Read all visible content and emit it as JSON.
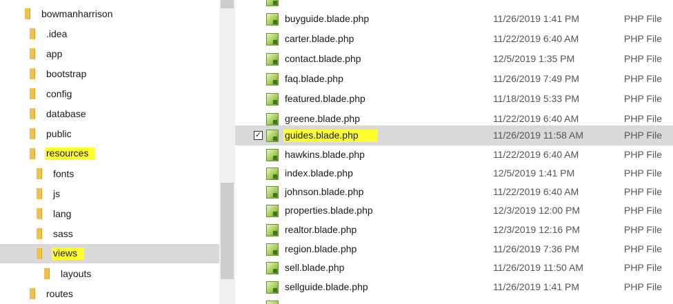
{
  "tree": {
    "items": [
      {
        "label": "bowmanharrison",
        "level": 0
      },
      {
        "label": ".idea",
        "level": 1
      },
      {
        "label": "app",
        "level": 1
      },
      {
        "label": "bootstrap",
        "level": 1
      },
      {
        "label": "config",
        "level": 1
      },
      {
        "label": "database",
        "level": 1
      },
      {
        "label": "public",
        "level": 1
      },
      {
        "label": "resources",
        "level": 1
      },
      {
        "label": "fonts",
        "level": 2
      },
      {
        "label": "js",
        "level": 2
      },
      {
        "label": "lang",
        "level": 2
      },
      {
        "label": "sass",
        "level": 2
      },
      {
        "label": "views",
        "level": 2
      },
      {
        "label": "layouts",
        "level": 3
      },
      {
        "label": "routes",
        "level": 1
      }
    ]
  },
  "files": {
    "items": [
      {
        "name": "buyguide.blade.php",
        "date": "11/26/2019 1:41 PM",
        "type": "PHP File"
      },
      {
        "name": "carter.blade.php",
        "date": "11/22/2019 6:40 AM",
        "type": "PHP File"
      },
      {
        "name": "contact.blade.php",
        "date": "12/5/2019 1:35 PM",
        "type": "PHP File"
      },
      {
        "name": "faq.blade.php",
        "date": "11/26/2019 7:49 PM",
        "type": "PHP File"
      },
      {
        "name": "featured.blade.php",
        "date": "11/18/2019 5:33 PM",
        "type": "PHP File"
      },
      {
        "name": "greene.blade.php",
        "date": "11/22/2019 6:40 AM",
        "type": "PHP File"
      },
      {
        "name": "guides.blade.php",
        "date": "11/26/2019 11:58 AM",
        "type": "PHP File"
      },
      {
        "name": "hawkins.blade.php",
        "date": "11/22/2019 6:40 AM",
        "type": "PHP File"
      },
      {
        "name": "index.blade.php",
        "date": "12/5/2019 1:41 PM",
        "type": "PHP File"
      },
      {
        "name": "johnson.blade.php",
        "date": "11/22/2019 6:40 AM",
        "type": "PHP File"
      },
      {
        "name": "properties.blade.php",
        "date": "12/3/2019 12:00 PM",
        "type": "PHP File"
      },
      {
        "name": "realtor.blade.php",
        "date": "12/3/2019 12:16 PM",
        "type": "PHP File"
      },
      {
        "name": "region.blade.php",
        "date": "11/26/2019 7:36 PM",
        "type": "PHP File"
      },
      {
        "name": "sell.blade.php",
        "date": "11/26/2019 11:50 AM",
        "type": "PHP File"
      },
      {
        "name": "sellguide.blade.php",
        "date": "11/26/2019 1:41 PM",
        "type": "PHP File"
      }
    ]
  },
  "colors": {
    "highlight": "#ffff2e",
    "selection": "#d9d9d9",
    "folder": "#f0c24a"
  }
}
